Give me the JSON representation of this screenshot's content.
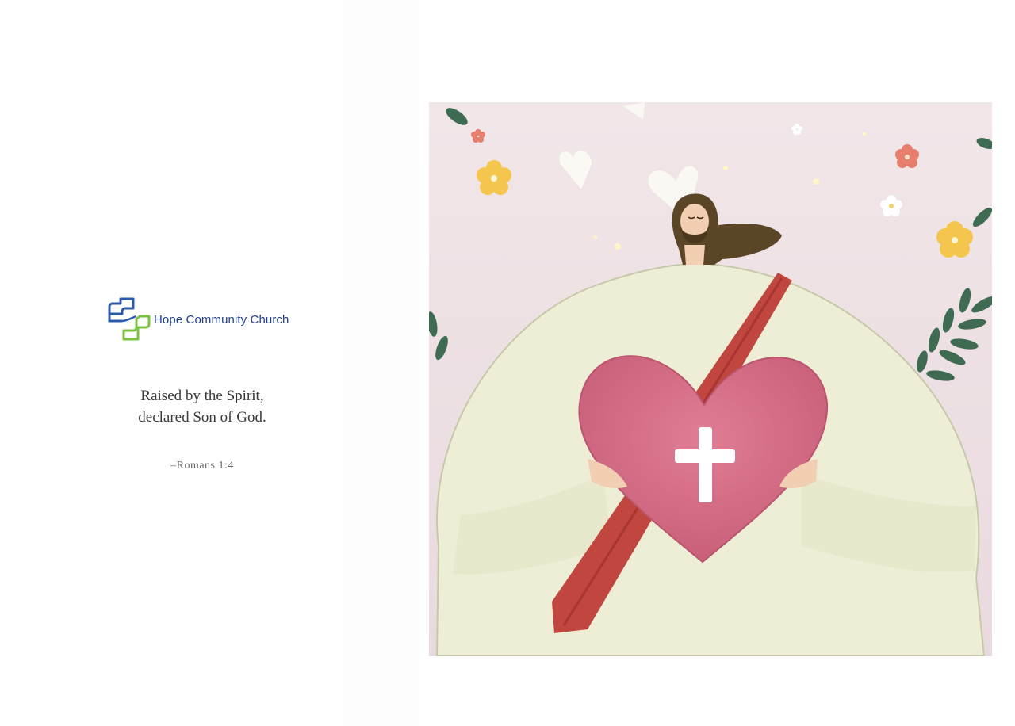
{
  "logo": {
    "name": "Hope Community Church"
  },
  "verse": {
    "line1": "Raised by the Spirit,",
    "line2": "declared Son of God.",
    "reference": "–Romans 1:4"
  },
  "artwork": {
    "subject": "illustration-jesus-holding-heart-with-cross"
  },
  "colors": {
    "brand_blue": "#1f3f8c",
    "brand_green": "#7cc242",
    "background_pink": "#efe2e6",
    "robe": "#eeeed6",
    "sash": "#c0463f",
    "heart": "#d8758c"
  }
}
